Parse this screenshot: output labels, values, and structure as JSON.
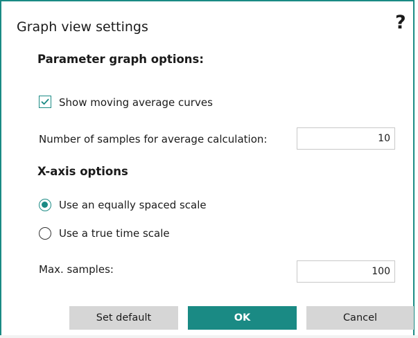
{
  "dialog": {
    "title": "Graph view settings",
    "help_glyph": "?"
  },
  "parameter_options": {
    "heading": "Parameter graph options:",
    "show_moving_average": {
      "label": "Show moving average curves",
      "checked": true
    },
    "samples_for_average": {
      "label": "Number of samples for average calculation:",
      "value": "10"
    }
  },
  "xaxis_options": {
    "heading": "X-axis options",
    "radios": [
      {
        "label": "Use an equally spaced scale",
        "selected": true
      },
      {
        "label": "Use a true time scale",
        "selected": false
      }
    ],
    "max_samples": {
      "label": "Max. samples:",
      "value": "100"
    }
  },
  "buttons": {
    "set_default": "Set default",
    "ok": "OK",
    "cancel": "Cancel"
  },
  "colors": {
    "accent": "#1a8a84",
    "button_gray": "#d6d6d6"
  },
  "icons": {
    "help": "help-icon",
    "check": "checkmark-icon"
  }
}
